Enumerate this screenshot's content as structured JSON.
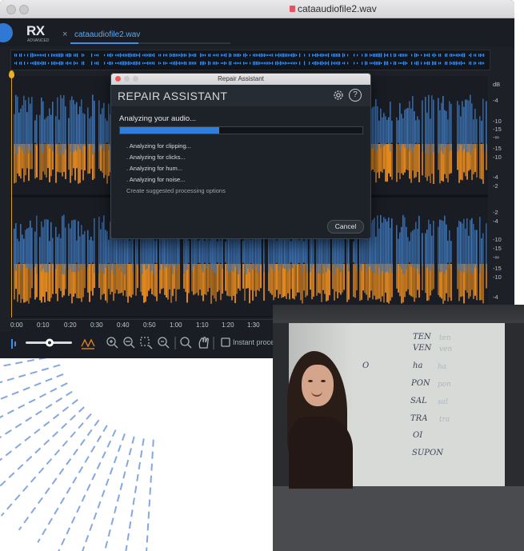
{
  "window": {
    "title": "cataaudiofile2.wav"
  },
  "app": {
    "logo": "RX",
    "logo_sub": "ADVANCED",
    "tab": {
      "name": "cataaudiofile2.wav",
      "close_glyph": "×"
    }
  },
  "ruler": {
    "labels": [
      "dB",
      "-4",
      "-10",
      "-15",
      "-∞",
      "-15",
      "-10",
      "-4",
      "-2",
      "-2",
      "-4",
      "-10",
      "-15",
      "-∞",
      "-15",
      "-10",
      "-4"
    ]
  },
  "timeline": {
    "ticks": [
      "0:00",
      "0:10",
      "0:20",
      "0:30",
      "0:40",
      "0:50",
      "1:00",
      "1:10",
      "1:20",
      "1:30"
    ]
  },
  "toolbar": {
    "instant_process_label": "Instant proce"
  },
  "dialog": {
    "window_title": "Repair Assistant",
    "heading": "REPAIR ASSISTANT",
    "status": "Analyzing your audio...",
    "progress": 0.41,
    "steps": [
      {
        "label": "Analyzing for clipping...",
        "bullet": "."
      },
      {
        "label": "Analyzing for clicks...",
        "bullet": "."
      },
      {
        "label": "Analyzing for hum...",
        "bullet": "."
      },
      {
        "label": "Analyzing for noise...",
        "bullet": "."
      },
      {
        "label": "Create suggested processing options",
        "bullet": ""
      }
    ],
    "cancel_label": "Cancel",
    "help_glyph": "?"
  },
  "whiteboard": {
    "words": [
      "TEN",
      "VEN",
      "ha",
      "PON",
      "SAL",
      "TRA",
      "OI",
      "SUPON"
    ],
    "faint_words": [
      "ten",
      "ven",
      "ha",
      "pon",
      "sal",
      "tra"
    ],
    "side_word": "O"
  },
  "colors": {
    "accent": "#3c8fe6",
    "waveform_blue": "#2f7bd6",
    "spectrum_orange": "#e58a1f",
    "ray_blue": "#5b8ad8"
  }
}
